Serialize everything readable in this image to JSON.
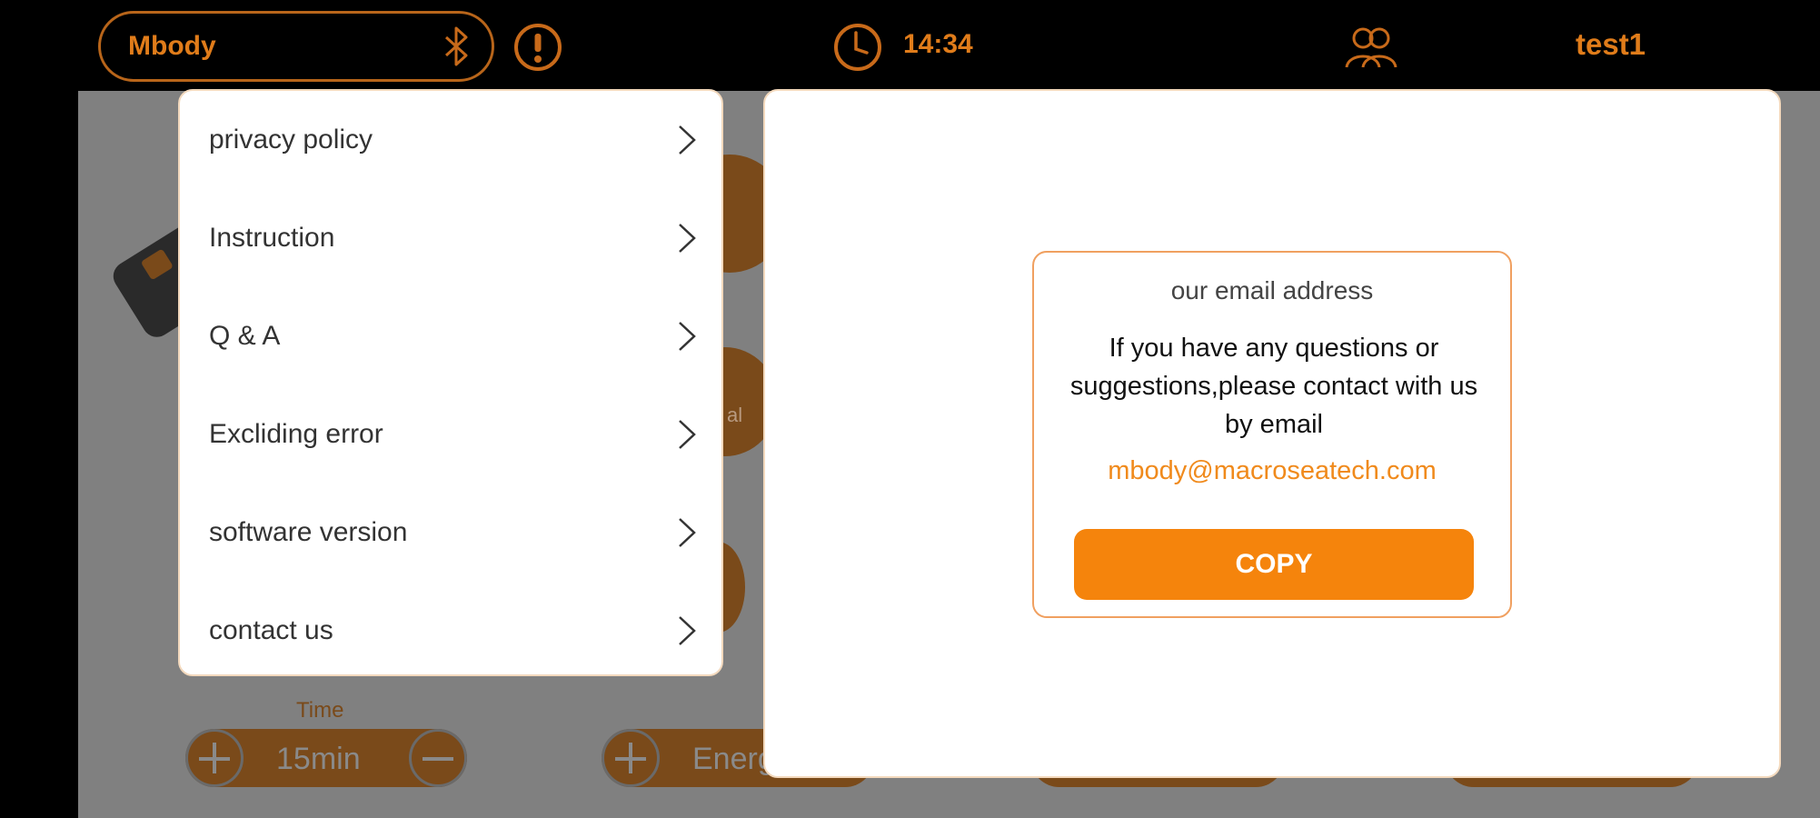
{
  "topbar": {
    "device_name": "Mbody",
    "time": "14:34",
    "user": "test1",
    "icons": [
      "bluetooth-icon",
      "alert-icon",
      "clock-icon",
      "users-icon"
    ]
  },
  "background": {
    "time_label": "Time",
    "time_value": "15min",
    "energy_label": "Energ",
    "partial_label": "al"
  },
  "menu": {
    "items": [
      {
        "label": "privacy policy"
      },
      {
        "label": "Instruction"
      },
      {
        "label": "Q & A"
      },
      {
        "label": "Excliding error"
      },
      {
        "label": "software version"
      },
      {
        "label": "contact us"
      }
    ]
  },
  "dialog": {
    "title": "our email address",
    "message": "If you have any questions or suggestions,please contact with us by email",
    "email": "mbody@macroseatech.com",
    "copy_label": "COPY"
  },
  "colors": {
    "accent": "#f5840c",
    "accent_dark": "#e07c1a",
    "background": "#808080",
    "topbar": "#000000"
  }
}
